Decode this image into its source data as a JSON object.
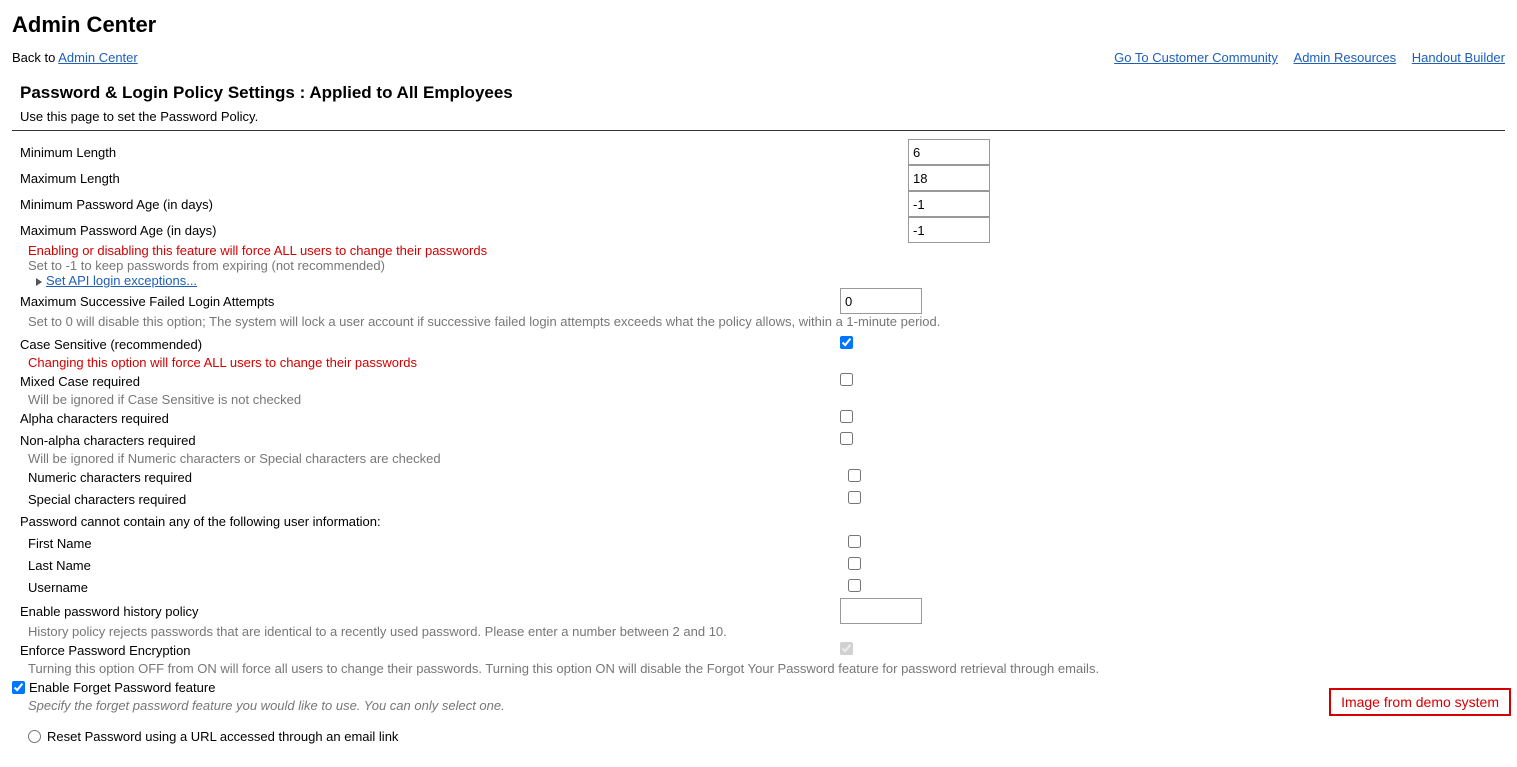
{
  "header": {
    "title": "Admin Center",
    "breadcrumb_prefix": "Back to ",
    "breadcrumb_link": "Admin Center"
  },
  "toplinks": {
    "community": "Go To Customer Community",
    "resources": "Admin Resources",
    "handout": "Handout Builder"
  },
  "section": {
    "title": "Password & Login Policy Settings : Applied to All Employees",
    "desc": "Use this page to set the Password Policy."
  },
  "fields": {
    "min_length": {
      "label": "Minimum Length",
      "value": "6"
    },
    "max_length": {
      "label": "Maximum Length",
      "value": "18"
    },
    "min_age": {
      "label": "Minimum Password Age (in days)",
      "value": "-1"
    },
    "max_age": {
      "label": "Maximum Password Age (in days)",
      "value": "-1",
      "warn": "Enabling or disabling this feature will force ALL users to change their passwords",
      "note": "Set to -1 to keep passwords from expiring (not recommended)",
      "api_link": "Set API login exceptions..."
    },
    "fail_attempts": {
      "label": "Maximum Successive Failed Login Attempts",
      "value": "0",
      "note": "Set to 0 will disable this option; The system will lock a user account if successive failed login attempts exceeds what the policy allows, within a 1-minute period."
    },
    "case_sensitive": {
      "label": "Case Sensitive (recommended)",
      "warn": "Changing this option will force ALL users to change their passwords"
    },
    "mixed_case": {
      "label": "Mixed Case required",
      "note": "Will be ignored if Case Sensitive is not checked"
    },
    "alpha": {
      "label": "Alpha characters required"
    },
    "non_alpha": {
      "label": "Non-alpha characters required",
      "note": "Will be ignored if Numeric characters or Special characters are checked"
    },
    "numeric": {
      "label": "Numeric characters required"
    },
    "special": {
      "label": "Special characters required"
    },
    "no_userinfo": {
      "label": "Password cannot contain any of the following user information:"
    },
    "first_name": {
      "label": "First Name"
    },
    "last_name": {
      "label": "Last Name"
    },
    "username": {
      "label": "Username"
    },
    "history": {
      "label": "Enable password history policy",
      "note": "History policy rejects passwords that are identical to a recently used password. Please enter a number between 2 and 10.",
      "value": ""
    },
    "encryption": {
      "label": "Enforce Password Encryption",
      "note": "Turning this option OFF from ON will force all users to change their passwords. Turning this option ON will disable the Forgot Your Password feature for password retrieval through emails."
    },
    "forget": {
      "label": "Enable Forget Password feature",
      "note": "Specify the forget password feature you would like to use. You can only select one."
    },
    "reset_url": {
      "label": "Reset Password using a URL accessed through an email link"
    }
  },
  "watermark": "Image from demo system"
}
